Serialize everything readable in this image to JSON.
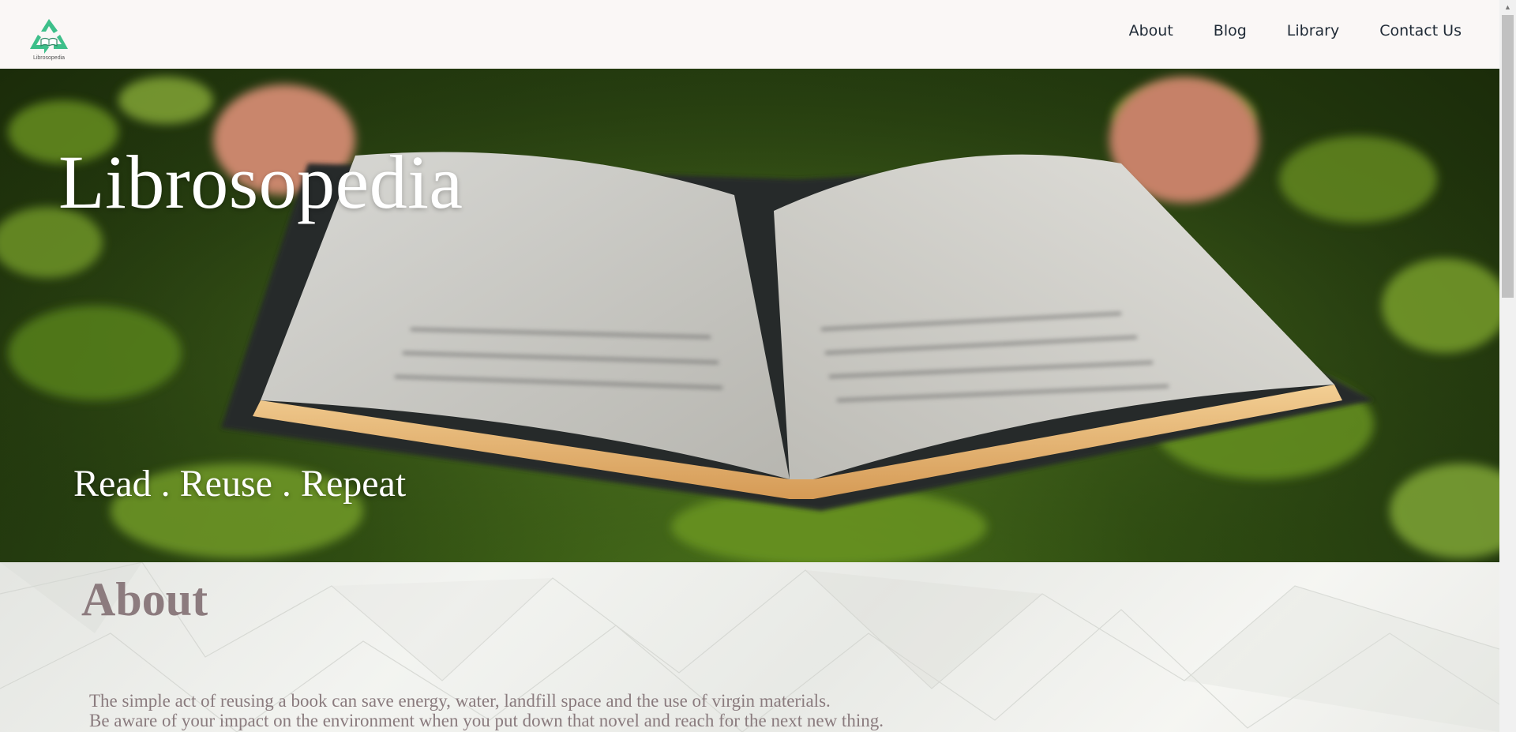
{
  "brand": {
    "logo_icon": "recycle-book-icon",
    "logo_caption": "Librosopedia",
    "accent_color": "#3dbf8a"
  },
  "nav": {
    "items": [
      {
        "label": "About"
      },
      {
        "label": "Blog"
      },
      {
        "label": "Library"
      },
      {
        "label": "Contact Us"
      }
    ]
  },
  "hero": {
    "title": "Librosopedia",
    "tagline": "Read . Reuse . Repeat",
    "background": "open-book-on-grass-photo"
  },
  "about": {
    "heading": "About",
    "lines": [
      "The simple act of reusing a book can save energy, water, landfill space and the use of virgin materials.",
      "Be aware of your impact on the environment when you put down that novel and reach for the next new thing."
    ]
  },
  "colors": {
    "nav_bg": "#faf7f6",
    "nav_text": "#1f2a36",
    "about_text": "#8a7b7e"
  }
}
